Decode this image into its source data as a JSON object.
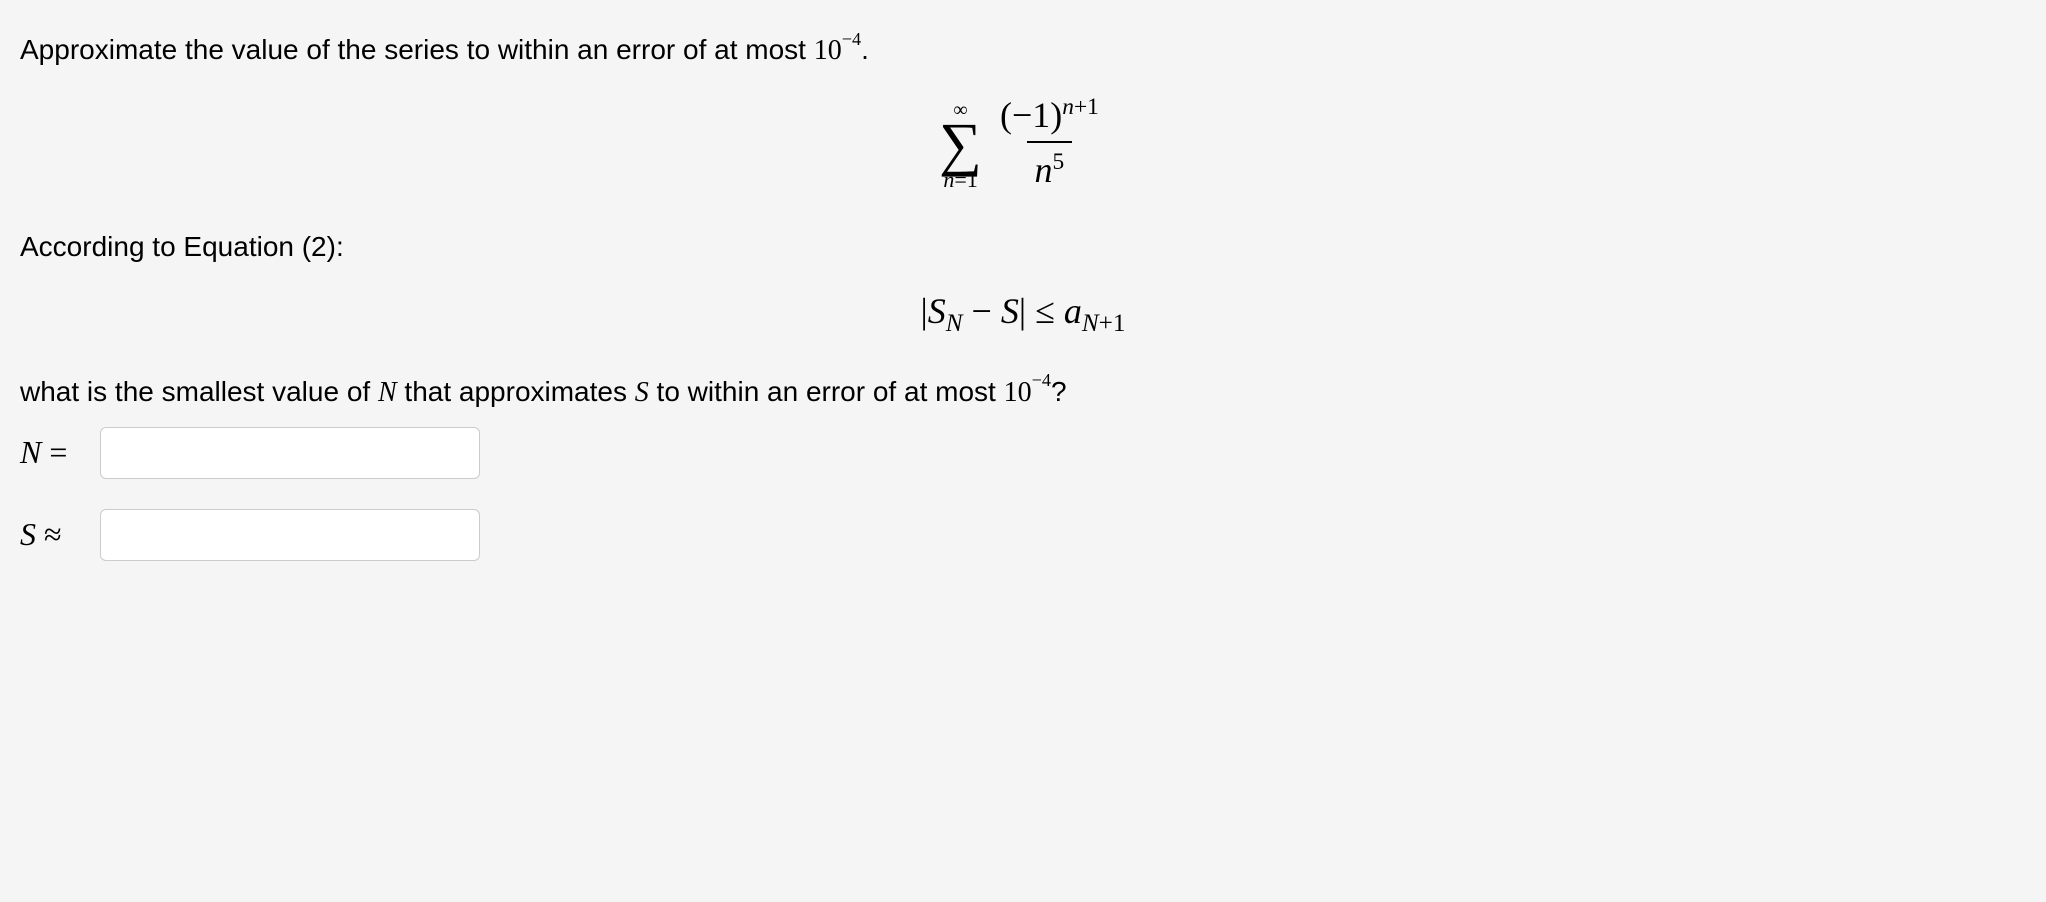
{
  "problem": {
    "intro_text": "Approximate the value of the series to within an error of at most ",
    "error_bound_base": "10",
    "error_bound_exp": "−4",
    "period": ".",
    "sum_upper": "∞",
    "sum_lower_var": "n",
    "sum_lower_eq": "=1",
    "numerator_base": "(−1)",
    "numerator_exp_var": "n",
    "numerator_exp_plus": "+1",
    "denominator_var": "n",
    "denominator_exp": "5"
  },
  "equation_ref": {
    "text": "According to Equation (2):",
    "inequality_left_S": "S",
    "inequality_left_sub": "N",
    "inequality_mid": " − ",
    "inequality_S": "S",
    "inequality_op": " ≤ ",
    "inequality_right_a": "a",
    "inequality_right_sub_N": "N",
    "inequality_right_sub_plus": "+1"
  },
  "question": {
    "text_part1": "what is the smallest value of ",
    "var_N": "N",
    "text_part2": " that approximates ",
    "var_S": "S",
    "text_part3": " to within an error of at most ",
    "error_base": "10",
    "error_exp": "−4",
    "qmark": "?"
  },
  "inputs": {
    "n_label_var": "N",
    "n_label_eq": " =",
    "s_label_var": "S",
    "s_label_approx": " ≈"
  }
}
